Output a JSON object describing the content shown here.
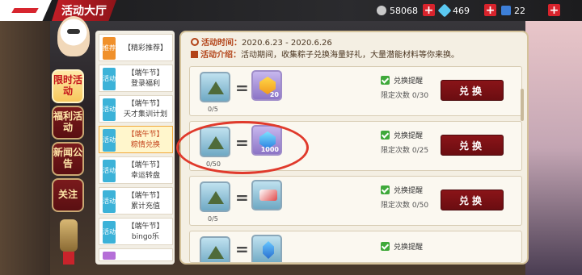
{
  "header": {
    "title": "活动大厅",
    "resources": [
      {
        "name": "coin",
        "icon": "coin-icon",
        "value": "58068"
      },
      {
        "name": "diamond",
        "icon": "diamond-icon",
        "value": "469"
      },
      {
        "name": "ticket",
        "icon": "ticket-icon",
        "value": "22"
      }
    ]
  },
  "side_tabs": [
    {
      "label": "限时活动",
      "active": true
    },
    {
      "label": "福利活动",
      "active": false
    },
    {
      "label": "新闻公告",
      "active": false
    },
    {
      "label": "关注",
      "active": false
    }
  ],
  "activities": [
    {
      "tag": "推荐",
      "title": "【精彩推荐】",
      "subtitle": ""
    },
    {
      "tag": "活动",
      "title": "【端午节】",
      "subtitle": "登录福利"
    },
    {
      "tag": "活动",
      "title": "【端午节】",
      "subtitle": "天才集训计划"
    },
    {
      "tag": "活动",
      "title": "【端午节】",
      "subtitle": "粽情兑换"
    },
    {
      "tag": "活动",
      "title": "【端午节】",
      "subtitle": "幸运转盘"
    },
    {
      "tag": "活动",
      "title": "【端午节】",
      "subtitle": "累计充值"
    },
    {
      "tag": "活动",
      "title": "【端午节】",
      "subtitle": "bingo乐"
    }
  ],
  "detail": {
    "time_label": "活动时间：",
    "time_value": "2020.6.23 - 2020.6.26",
    "intro_label": "活动介绍：",
    "intro_value": "活动期间，收集粽子兑换海量好礼，大量潜能材料等你来换。",
    "rows": [
      {
        "cost_count": "0/5",
        "reward_badge": "20",
        "remind": "兑换提醒",
        "limit": "限定次数 0/30",
        "button": "兑换"
      },
      {
        "cost_count": "0/50",
        "reward_badge": "1000",
        "remind": "兑换提醒",
        "limit": "限定次数 0/25",
        "button": "兑换"
      },
      {
        "cost_count": "0/5",
        "reward_badge": "",
        "remind": "兑换提醒",
        "limit": "限定次数 0/50",
        "button": "兑换"
      },
      {
        "cost_count": "",
        "reward_badge": "",
        "remind": "兑换提醒",
        "limit": "",
        "button": ""
      }
    ]
  },
  "colors": {
    "accent": "#c21e27",
    "button": "#7a1014",
    "check": "#3fa93a"
  }
}
